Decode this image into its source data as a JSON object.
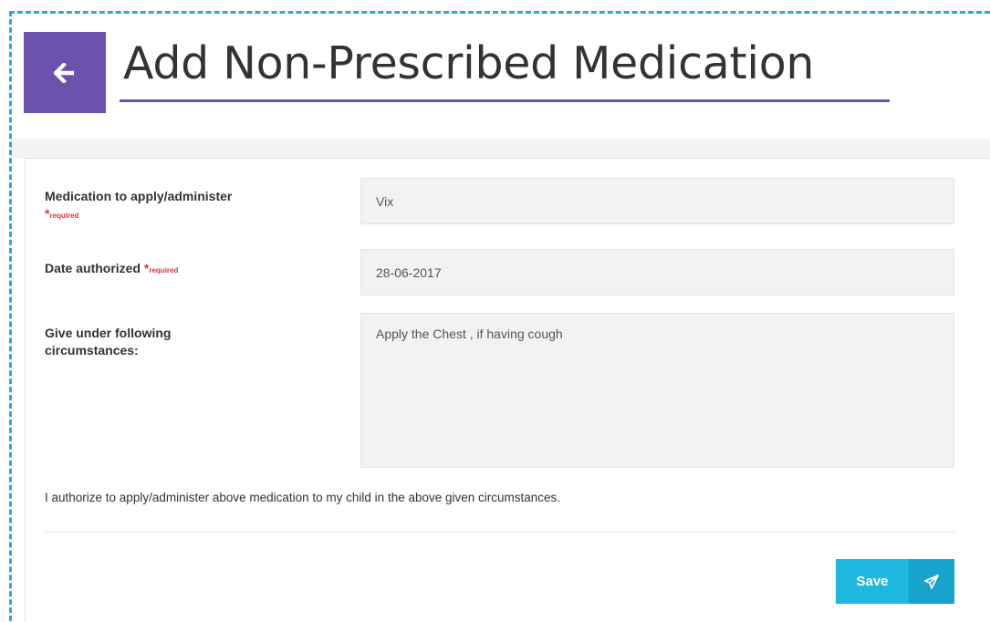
{
  "header": {
    "title": "Add Non-Prescribed Medication",
    "back_icon": "arrow-left-icon",
    "accent_color": "#6a52ad"
  },
  "form": {
    "required_text": "required",
    "required_star": "*",
    "medication": {
      "label": "Medication to apply/administer",
      "value": "Vix"
    },
    "date": {
      "label": "Date authorized",
      "value": "28-06-2017"
    },
    "circumstances": {
      "label_line1": "Give under following",
      "label_line2": "circumstances:",
      "value": "Apply the Chest , if having cough"
    },
    "authorization_statement": "I authorize to apply/administer above medication to my child in the above given circumstances.",
    "save_label": "Save",
    "save_icon": "paper-plane-icon",
    "button_color": "#20b7e0"
  }
}
